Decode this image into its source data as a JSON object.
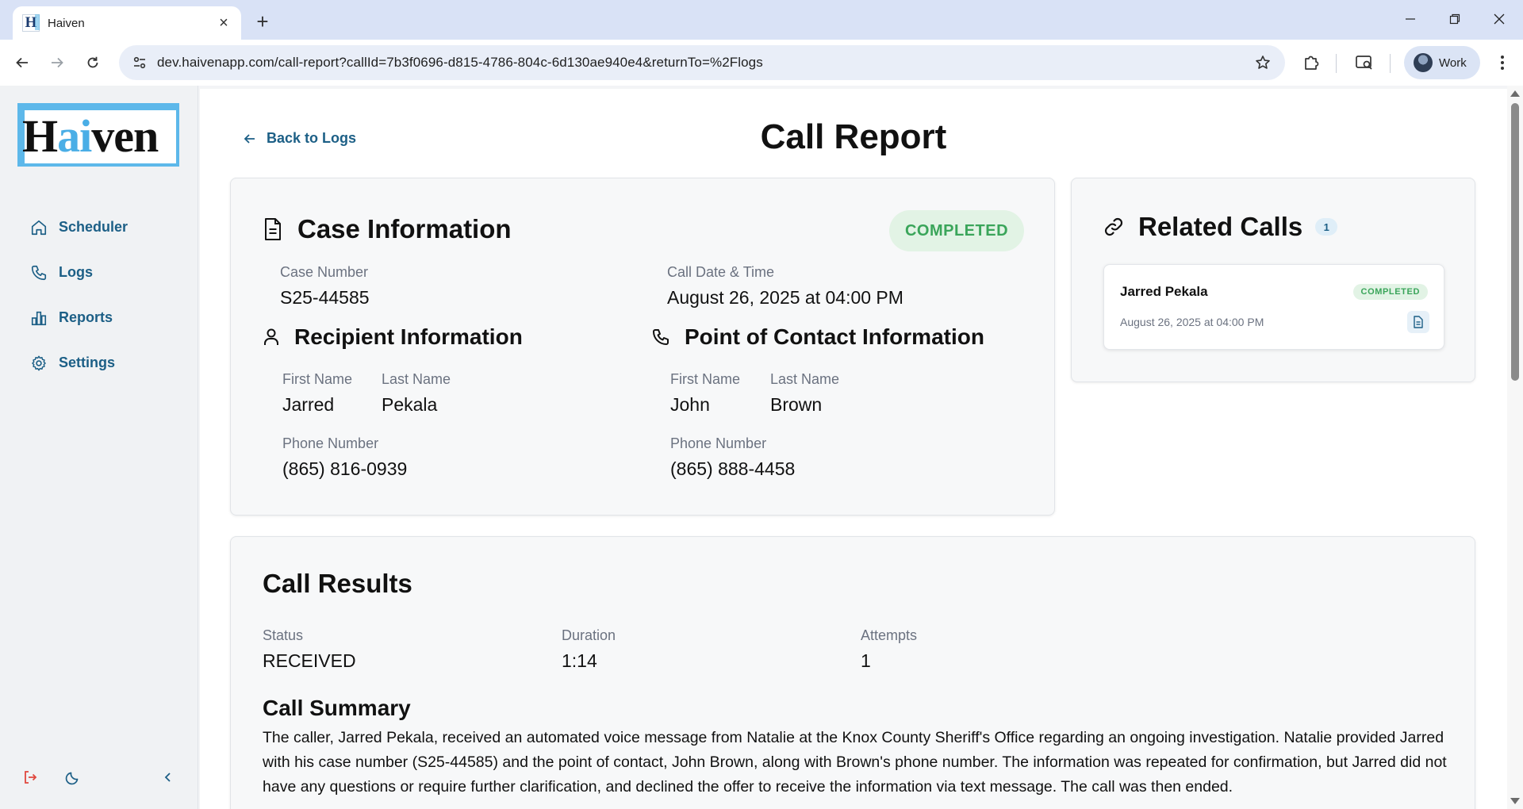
{
  "browser": {
    "tab_title": "Haiven",
    "tab_favicon_letter": "H",
    "url": "dev.haivenapp.com/call-report?callId=7b3f0696-d815-4786-804c-6d130ae940e4&returnTo=%2Flogs",
    "profile_label": "Work"
  },
  "sidebar": {
    "logo": {
      "prefix": "H",
      "highlight": "ai",
      "suffix": "ven"
    },
    "items": [
      {
        "label": "Scheduler",
        "icon": "home-icon"
      },
      {
        "label": "Logs",
        "icon": "phone-icon"
      },
      {
        "label": "Reports",
        "icon": "bar-chart-icon"
      },
      {
        "label": "Settings",
        "icon": "gear-icon"
      }
    ]
  },
  "page": {
    "back_label": "Back to Logs",
    "title": "Call Report"
  },
  "case": {
    "title": "Case Information",
    "status": "COMPLETED",
    "case_number_label": "Case Number",
    "case_number": "S25-44585",
    "datetime_label": "Call Date & Time",
    "datetime": "August 26, 2025 at 04:00 PM"
  },
  "recipient": {
    "title": "Recipient Information",
    "first_name_label": "First Name",
    "first_name": "Jarred",
    "last_name_label": "Last Name",
    "last_name": "Pekala",
    "phone_label": "Phone Number",
    "phone": "(865) 816-0939"
  },
  "contact": {
    "title": "Point of Contact Information",
    "first_name_label": "First Name",
    "first_name": "John",
    "last_name_label": "Last Name",
    "last_name": "Brown",
    "phone_label": "Phone Number",
    "phone": "(865) 888-4458"
  },
  "related": {
    "title": "Related Calls",
    "count": "1",
    "items": [
      {
        "name": "Jarred Pekala",
        "status": "COMPLETED",
        "datetime": "August 26, 2025 at 04:00 PM"
      }
    ]
  },
  "results": {
    "title": "Call Results",
    "status_label": "Status",
    "status": "RECEIVED",
    "duration_label": "Duration",
    "duration": "1:14",
    "attempts_label": "Attempts",
    "attempts": "1",
    "summary_title": "Call Summary",
    "summary": "The caller, Jarred Pekala, received an automated voice message from Natalie at the Knox County Sheriff's Office regarding an ongoing investigation. Natalie provided Jarred with his case number (S25-44585) and the point of contact, John Brown, along with Brown's phone number. The information was repeated for confirmation, but Jarred did not have any questions or require further clarification, and declined the offer to receive the information via text message. The call was then ended."
  },
  "colors": {
    "accent": "#1c5f86",
    "logo_blue": "#5db8ea",
    "completed_text": "#3aa55a",
    "completed_bg": "#e2f3e5",
    "logout_red": "#e0483e"
  }
}
